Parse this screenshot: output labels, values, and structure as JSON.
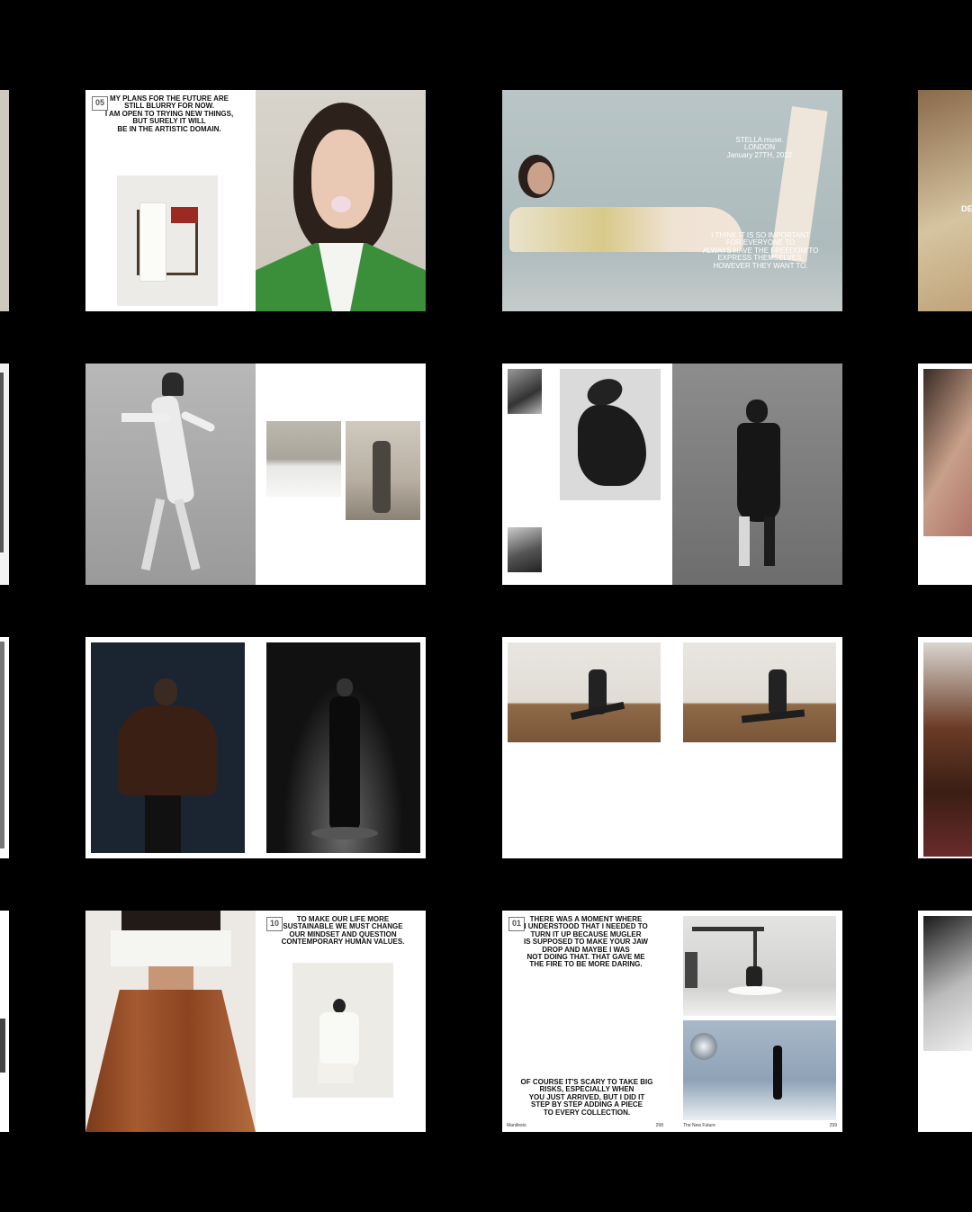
{
  "palette": {
    "background": "#000000",
    "paper": "#ffffff"
  },
  "spreads": {
    "s1": {
      "badge": "05",
      "quote": "MY PLANS FOR THE FUTURE ARE\nSTILL BLURRY FOR NOW.\nI AM OPEN TO TRYING NEW THINGS,\nBUT SURELY IT WILL\nBE IN THE ARTISTIC DOMAIN."
    },
    "s2": {
      "event": "STELLA muse.\nLONDON\nJanuary 27TH, 2022",
      "quote": "I THINK IT IS SO IMPORTANT\nFOR EVERYONE TO\nALWAYS HAVE THE FREEDOM TO\nEXPRESS THEMSELVES,\nHOWEVER THEY WANT TO."
    },
    "s7": {
      "badge": "10",
      "quote": "TO MAKE OUR LIFE MORE\nSUSTAINABLE WE MUST CHANGE\nOUR MINDSET AND QUESTION\nCONTEMPORARY HUMAN VALUES."
    },
    "s8": {
      "badge": "01",
      "quote_top": "THERE WAS A MOMENT WHERE\nI UNDERSTOOD THAT I NEEDED TO\nTURN IT UP BECAUSE MUGLER\nIS SUPPOSED TO MAKE YOUR JAW\nDROP AND MAYBE I WAS\nNOT DOING THAT. THAT GAVE ME\nTHE FIRE TO BE MORE DARING.",
      "quote_bottom": "OF COURSE IT'S SCARY TO TAKE BIG\nRISKS, ESPECIALLY WHEN\nYOU JUST ARRIVED, BUT I DID IT\nSTEP BY STEP ADDING A PIECE\nTO EVERY COLLECTION.",
      "footer_left": "Manifesto",
      "page_left": "298",
      "footer_right": "The New Future",
      "page_right": "299"
    }
  }
}
